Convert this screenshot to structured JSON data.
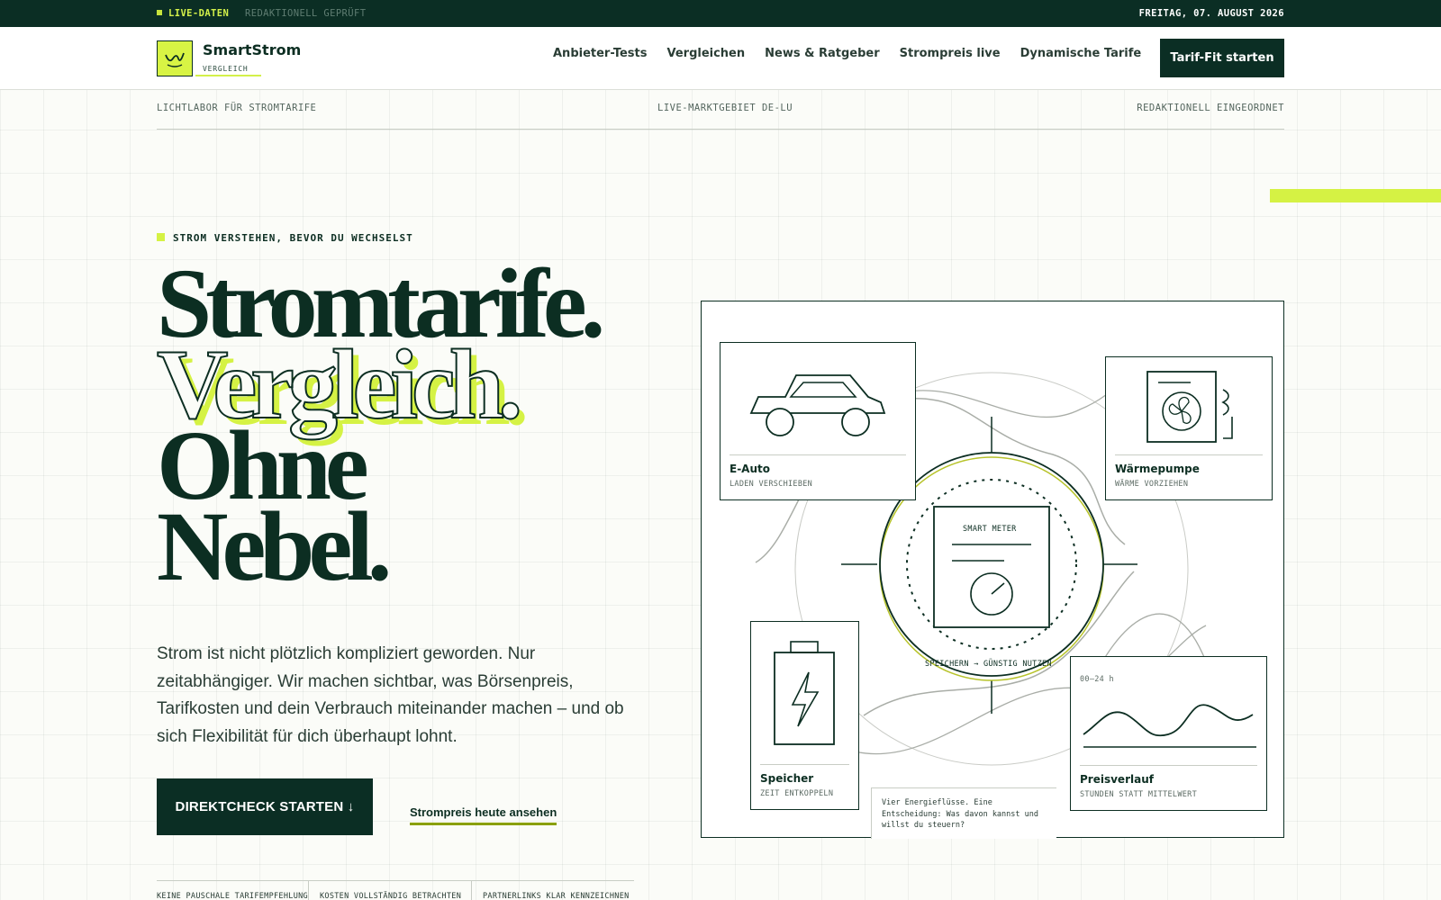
{
  "topbar": {
    "live_label": "LIVE-DATEN",
    "checked_label": "REDAKTIONELL GEPRÜFT",
    "date": "FREITAG, 07. AUGUST 2026"
  },
  "header": {
    "brand_name": "SmartStrom",
    "brand_sub": "VERGLEICH",
    "nav": [
      "Anbieter-Tests",
      "Vergleichen",
      "News & Ratgeber",
      "Strompreis live",
      "Dynamische Tarife"
    ],
    "cta": "Tarif-Fit starten"
  },
  "strip": {
    "left": "LICHTLABOR FÜR STROMTARIFE",
    "center": "LIVE-MARKTGEBIET DE-LU",
    "right": "REDAKTIONELL EINGEORDNET"
  },
  "hero": {
    "eyebrow": "STROM VERSTEHEN, BEVOR DU WECHSELST",
    "headline": [
      "Stromtarife.",
      "Vergleich.",
      "Ohne",
      "Nebel."
    ],
    "lead": "Strom ist nicht plötzlich kompliziert geworden. Nur zeitabhängiger. Wir machen sichtbar, was Börsenpreis, Tarifkosten und dein Verbrauch miteinander machen – und ob sich Flexibilität für dich überhaupt lohnt.",
    "cta_primary": "DIREKTCHECK STARTEN ↓",
    "cta_secondary": "Strompreis heute ansehen",
    "tags": [
      "KEINE PAUSCHALE TARIFEMPFEHLUNG",
      "KOSTEN VOLLSTÄNDIG BETRACHTEN",
      "PARTNERLINKS KLAR KENNZEICHNEN"
    ]
  },
  "diagram": {
    "ev": {
      "title": "E-Auto",
      "sub": "LADEN VERSCHIEBEN",
      "icon": "car-icon"
    },
    "heatpump": {
      "title": "Wärmepumpe",
      "sub": "WÄRME VORZIEHEN",
      "icon": "heat-pump-icon"
    },
    "storage": {
      "title": "Speicher",
      "sub": "ZEIT ENTKOPPELN",
      "icon": "battery-icon"
    },
    "price": {
      "title": "Preisverlauf",
      "sub": "STUNDEN STATT MITTELWERT",
      "range": "00–24 h",
      "icon": "price-curve-icon"
    },
    "meter_label": "SMART METER",
    "ring_label": "SPEICHERN → GÜNSTIG NUTZEN",
    "note": "Vier Energieflüsse. Eine Entscheidung: Was davon kannst und willst du steuern?"
  },
  "colors": {
    "dark_green": "#0b2e24",
    "lime": "#d5f244",
    "olive": "#8aa000",
    "background": "#fbfcf8"
  }
}
